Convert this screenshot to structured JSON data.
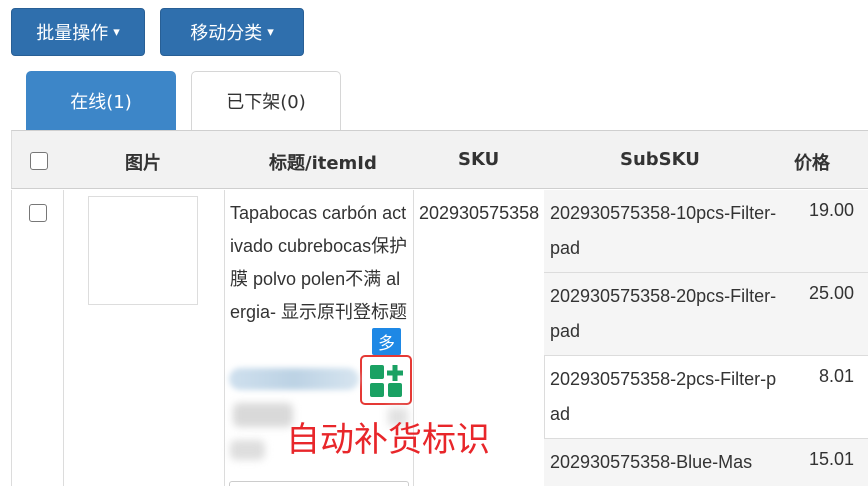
{
  "toolbar": {
    "batch_label": "批量操作",
    "move_label": "移动分类",
    "caret": "▾"
  },
  "tabs": [
    {
      "label": "在线(1)",
      "active": true
    },
    {
      "label": "已下架(0)",
      "active": false
    }
  ],
  "table": {
    "headers": {
      "image": "图片",
      "title": "标题/itemId",
      "sku": "SKU",
      "subsku": "SubSKU",
      "price": "价格"
    },
    "row": {
      "title": "Tapabocas carbón activado cubrebocas保护膜 polvo polen不满 alergia- 显示原刊登标题",
      "multi_badge": "多",
      "sku": "202930575358",
      "variants": [
        {
          "subsku": "202930575358-10pcs-Filter-pad",
          "price": "19.00"
        },
        {
          "subsku": "202930575358-20pcs-Filter-pad",
          "price": "25.00"
        },
        {
          "subsku": "202930575358-2pcs-Filter-pad",
          "price": "8.01"
        },
        {
          "subsku": "202930575358-Blue-Mas",
          "price": "15.01"
        }
      ]
    }
  },
  "annotation": "自动补货标识",
  "colors": {
    "primary_button": "#2f6fad",
    "active_tab": "#3d86c8",
    "badge": "#1e88e5",
    "restock_icon": "#1aa163",
    "annotation_red": "#e8262a"
  }
}
